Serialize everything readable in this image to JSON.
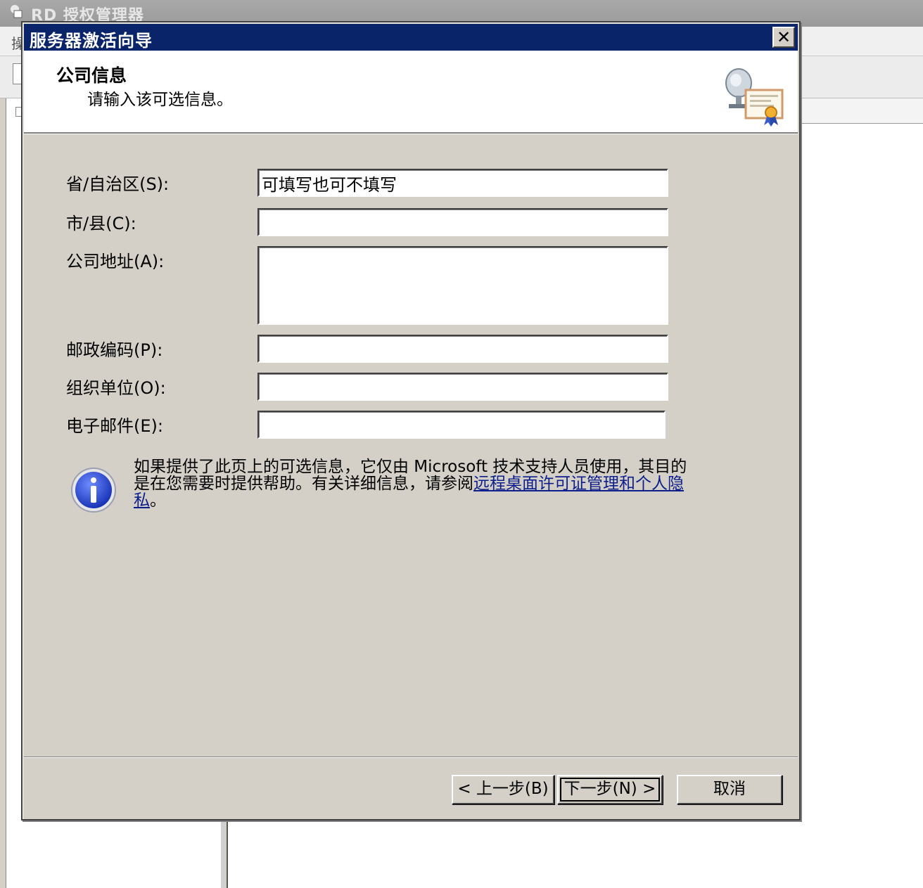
{
  "background_app": {
    "title": "RD 授权管理器",
    "menu_char": "操"
  },
  "dialog": {
    "title": "服务器激活向导",
    "close_label": "✕",
    "header": {
      "title": "公司信息",
      "subtitle": "请输入该可选信息。"
    },
    "fields": [
      {
        "label": "省/自治区(S):",
        "value": "可填写也可不填写"
      },
      {
        "label": "市/县(C):",
        "value": ""
      },
      {
        "label": "公司地址(A):",
        "value": ""
      },
      {
        "label": "邮政编码(P):",
        "value": ""
      },
      {
        "label": "组织单位(O):",
        "value": ""
      },
      {
        "label": "电子邮件(E):",
        "value": ""
      }
    ],
    "info": {
      "text_before": "如果提供了此页上的可选信息，它仅由 Microsoft 技术支持人员使用，其目的是在您需要时提供帮助。有关详细信息，请参阅",
      "link_text": "远程桌面许可证管理和个人隐私",
      "text_after": "。"
    },
    "buttons": {
      "back": "< 上一步(B)",
      "next": "下一步(N) >",
      "cancel": "取消"
    }
  },
  "icons": {
    "info": "info-icon",
    "header": "satellite-certificate-icon",
    "app": "server-icon"
  },
  "colors": {
    "titlebar": "#0a246a",
    "dialog_face": "#d4d0c8",
    "link": "#0b1e8c"
  }
}
